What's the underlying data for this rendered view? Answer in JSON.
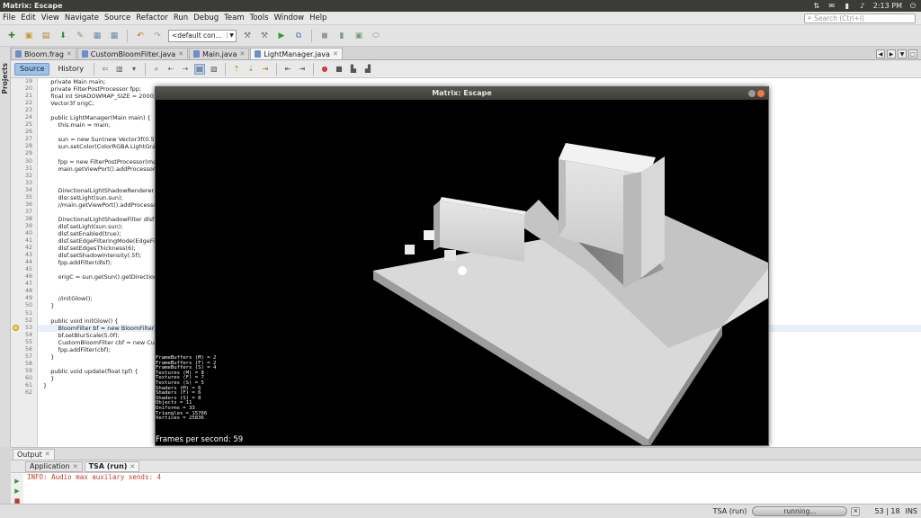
{
  "system_bar": {
    "title": "Matrix: Escape",
    "time": "2:13 PM"
  },
  "menu": {
    "items": [
      "File",
      "Edit",
      "View",
      "Navigate",
      "Source",
      "Refactor",
      "Run",
      "Debug",
      "Team",
      "Tools",
      "Window",
      "Help"
    ],
    "search_placeholder": "Search (Ctrl+I)"
  },
  "toolbar": {
    "config": "<default con..."
  },
  "projects_label": "Projects",
  "file_tabs": [
    {
      "label": "Bloom.frag",
      "active": false
    },
    {
      "label": "CustomBloomFilter.java",
      "active": false
    },
    {
      "label": "Main.java",
      "active": false
    },
    {
      "label": "LightManager.java",
      "active": true
    }
  ],
  "editor_tabs": {
    "source": "Source",
    "history": "History"
  },
  "code_lines": [
    {
      "n": "19",
      "t": "    private Main main;"
    },
    {
      "n": "20",
      "t": "    private FilterPostProcessor fpp;"
    },
    {
      "n": "21",
      "t": "    final int SHADOWMAP_SIZE = 2000;"
    },
    {
      "n": "22",
      "t": "    Vector3f origC;"
    },
    {
      "n": "23",
      "t": ""
    },
    {
      "n": "24",
      "t": "    public LightManager(Main main) {"
    },
    {
      "n": "25",
      "t": "        this.main = main;"
    },
    {
      "n": "26",
      "t": ""
    },
    {
      "n": "27",
      "t": "        sun = new Sun(new Vector3f(0.5f,"
    },
    {
      "n": "28",
      "t": "        sun.setColor(ColorRGBA.LightGray"
    },
    {
      "n": "29",
      "t": ""
    },
    {
      "n": "30",
      "t": "        fpp = new FilterPostProcessor(ma"
    },
    {
      "n": "31",
      "t": "        main.getViewPort().addProcessor"
    },
    {
      "n": "32",
      "t": ""
    },
    {
      "n": "33",
      "t": ""
    },
    {
      "n": "34",
      "t": "        DirectionalLightShadowRenderer d"
    },
    {
      "n": "35",
      "t": "        dlsr.setLight(sun.sun);"
    },
    {
      "n": "36",
      "t": "        //main.getViewPort().addProcesso"
    },
    {
      "n": "37",
      "t": ""
    },
    {
      "n": "38",
      "t": "        DirectionalLightShadowFilter dlsf ="
    },
    {
      "n": "39",
      "t": "        dlsf.setLight(sun.sun);"
    },
    {
      "n": "40",
      "t": "        dlsf.setEnabled(true);"
    },
    {
      "n": "41",
      "t": "        dlsf.setEdgeFilteringMode(EdgeFil"
    },
    {
      "n": "42",
      "t": "        dlsf.setEdgesThickness(6);"
    },
    {
      "n": "43",
      "t": "        dlsf.setShadowIntensity(.5f);"
    },
    {
      "n": "44",
      "t": "        fpp.addFilter(dlsf);"
    },
    {
      "n": "45",
      "t": ""
    },
    {
      "n": "46",
      "t": "        origC = sun.getSun().getDirection"
    },
    {
      "n": "47",
      "t": ""
    },
    {
      "n": "48",
      "t": ""
    },
    {
      "n": "49",
      "t": "        //initGlow();"
    },
    {
      "n": "50",
      "t": "    }"
    },
    {
      "n": "51",
      "t": ""
    },
    {
      "n": "52",
      "t": "    public void initGlow() {"
    },
    {
      "n": "53",
      "t": "        BloomFilter bf = new BloomFilter(B"
    },
    {
      "n": "54",
      "t": "        bf.setBlurScale(5.0f);"
    },
    {
      "n": "55",
      "t": "        CustomBloomFilter cbf = new Cus"
    },
    {
      "n": "56",
      "t": "        fpp.addFilter(cbf);"
    },
    {
      "n": "57",
      "t": "    }"
    },
    {
      "n": "58",
      "t": ""
    },
    {
      "n": "59",
      "t": "    public void update(float tpf) {"
    },
    {
      "n": "60",
      "t": "    }"
    },
    {
      "n": "61",
      "t": "}"
    },
    {
      "n": "62",
      "t": ""
    }
  ],
  "game_window": {
    "title": "Matrix: Escape",
    "stats": [
      "FrameBuffers (M) = 2",
      "FrameBuffers (F) = 2",
      "FrameBuffers (S) = 4",
      "Textures (M) = 8",
      "Textures (F) = 7",
      "Textures (S) = 5",
      "Shaders (M) = 6",
      "Shaders (F) = 6",
      "Shaders (S) = 8",
      "Objects = 11",
      "Uniforms = 33",
      "Triangles = 15766",
      "Vertices = 25836"
    ],
    "fps": "Frames per second: 59"
  },
  "output": {
    "title": "Output",
    "tabs": [
      {
        "label": "Application",
        "active": false
      },
      {
        "label": "TSA (run)",
        "active": true
      }
    ],
    "lines": [
      "INFO: Audio max auxilary sends: 4"
    ]
  },
  "status": {
    "process": "TSA (run)",
    "progress": "running...",
    "position": "53 | 18",
    "mode": "INS"
  }
}
